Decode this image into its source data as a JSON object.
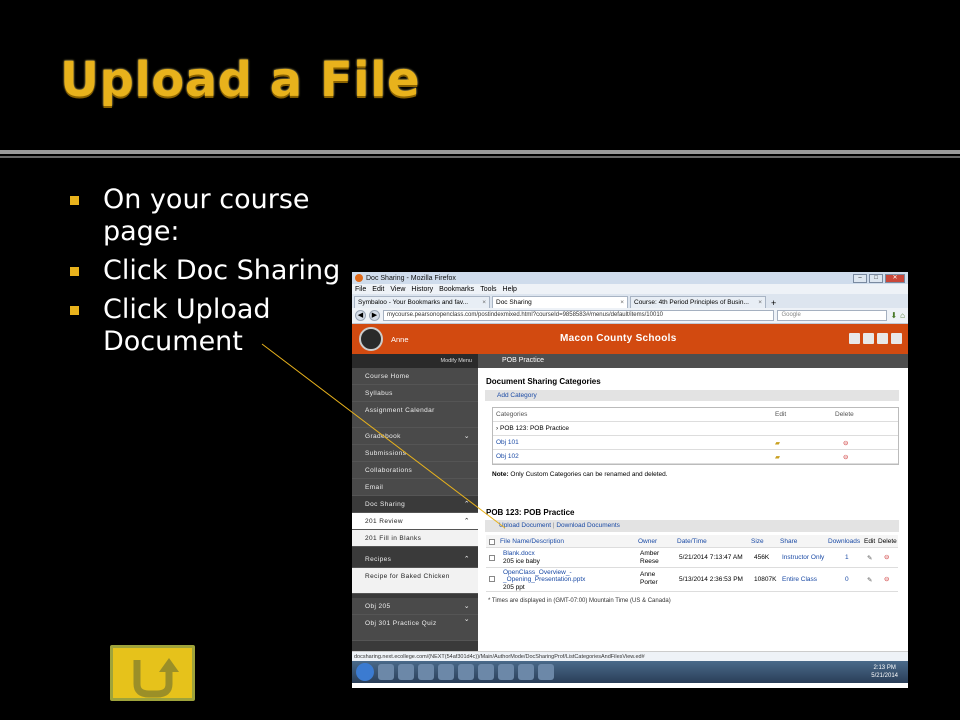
{
  "slide": {
    "title": "Upload a File",
    "bullets": [
      "On your course page:",
      "Click Doc Sharing",
      "Click Upload Document"
    ]
  },
  "colors": {
    "accent": "#e8b21c",
    "orange_bar": "#d24a10",
    "sidebar": "#3a3a3a"
  },
  "screenshot": {
    "window_title": "Doc Sharing - Mozilla Firefox",
    "menu": [
      "File",
      "Edit",
      "View",
      "History",
      "Bookmarks",
      "Tools",
      "Help"
    ],
    "tabs": [
      {
        "label": "Symbaloo - Your Bookmarks and fav..."
      },
      {
        "label": "Doc Sharing"
      },
      {
        "label": "Course: 4th Period Principles of Busin..."
      }
    ],
    "url": "mycourse.pearsonopenclass.com/postindexmixed.html?courseId=9858583#/menus/default/items/10010",
    "search_placeholder": "Google",
    "user_name": "Anne",
    "school_name": "Macon County Schools",
    "modify_menu": "Modify Menu",
    "course_bar": "POB Practice",
    "sidebar": [
      "Course Home",
      "Syllabus",
      "Assignment Calendar",
      "Gradebook",
      "Submissions",
      "Collaborations",
      "Email",
      "Doc Sharing",
      "201 Review",
      "201 Fill in Blanks",
      "Recipes",
      "Recipe for Baked Chicken",
      "Obj 205",
      "Obj 301 Practice Quiz"
    ],
    "doc_categories_heading": "Document Sharing Categories",
    "add_category": "Add Category",
    "cat_headers": [
      "Categories",
      "Edit",
      "Delete"
    ],
    "cat_rows": [
      "POB 123: POB Practice",
      "Obj 101",
      "Obj 102"
    ],
    "note_label": "Note:",
    "note_text": "Only Custom Categories can be renamed and deleted.",
    "files_heading": "POB 123: POB Practice",
    "upload_document": "Upload Document",
    "download_documents": "Download Documents",
    "file_headers": [
      "File Name/Description",
      "Owner",
      "Date/Time",
      "Size",
      "Share",
      "Downloads",
      "Edit",
      "Delete"
    ],
    "files": [
      {
        "name": "Blank.docx",
        "desc": "205 ice baby",
        "owner1": "Amber",
        "owner2": "Reese",
        "date": "5/21/2014 7:13:47 AM",
        "size": "456K",
        "share": "Instructor Only",
        "downloads": "1"
      },
      {
        "name": "OpenClass_Overview_-_Opening_Presentation.pptx",
        "desc": "205 ppt",
        "owner1": "Anne",
        "owner2": "Porter",
        "date": "5/13/2014 2:36:53 PM",
        "size": "10807K",
        "share": "Entire Class",
        "downloads": "0"
      }
    ],
    "times_note": "* Times are displayed in (GMT-07:00) Mountain Time (US & Canada)",
    "status_url": "docsharing.next.ecollege.com/(NEXT(54af301d4c))/Main/AuthorMode/DocSharingProf/ListCategoriesAndFilesView.ed#",
    "clock_time": "2:13 PM",
    "clock_date": "5/21/2014"
  }
}
